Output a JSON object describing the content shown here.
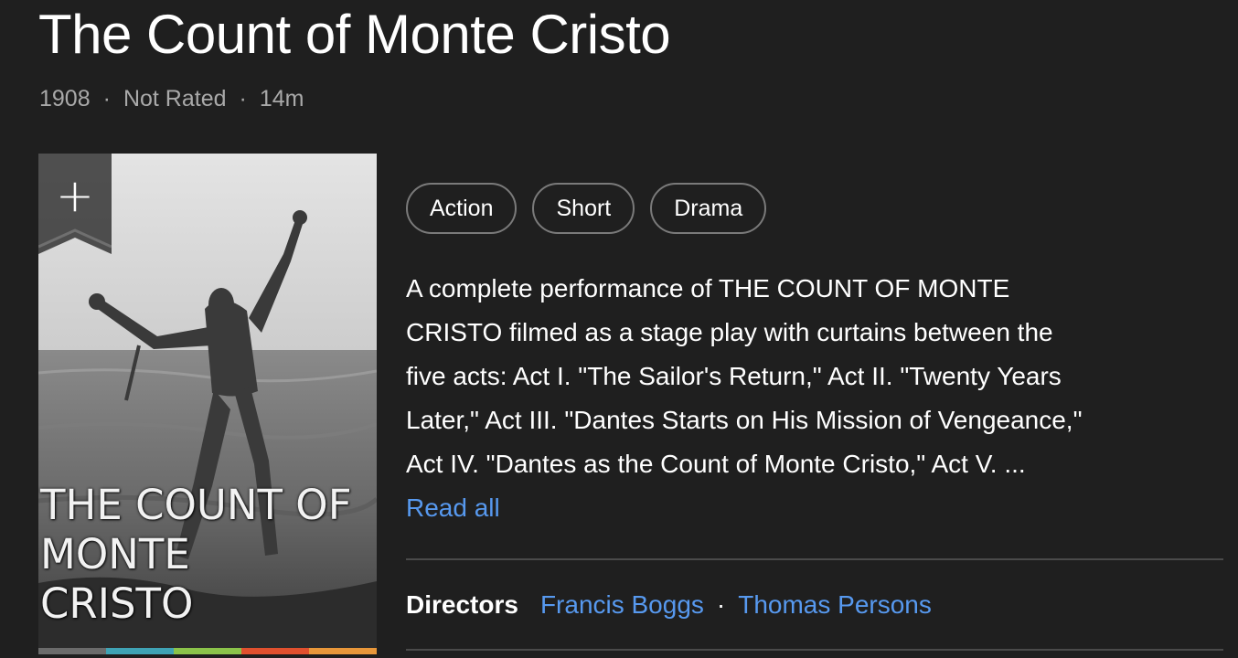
{
  "title": "The Count of Monte Cristo",
  "meta": {
    "year": "1908",
    "rating": "Not Rated",
    "runtime": "14m",
    "separator": "·"
  },
  "poster": {
    "caption_lines": [
      "THE COUNT OF",
      "MONTE",
      "CRISTO"
    ],
    "watchlist_icon": "plus-icon",
    "watchlist_symbol": "+",
    "colorbar": [
      "#6b6b6b",
      "#3fa3b5",
      "#8bc34a",
      "#e0502e",
      "#e8973a"
    ]
  },
  "genres": [
    "Action",
    "Short",
    "Drama"
  ],
  "plot": {
    "lines": [
      "A complete performance of THE COUNT OF MONTE",
      "CRISTO filmed as a stage play with curtains between the",
      "five acts: Act I. \"The Sailor's Return,\" Act II. \"Twenty Years",
      "Later,\" Act III. \"Dantes Starts on His Mission of Vengeance,\"",
      "Act IV. \"Dantes as the Count of Monte Cristo,\" Act V. ..."
    ],
    "read_all": "Read all"
  },
  "credits": {
    "label": "Directors",
    "names": [
      "Francis Boggs",
      "Thomas Persons"
    ],
    "separator": "·"
  },
  "colors": {
    "background": "#1f1f1f",
    "link": "#5799ef",
    "muted": "#a9a9a9"
  }
}
